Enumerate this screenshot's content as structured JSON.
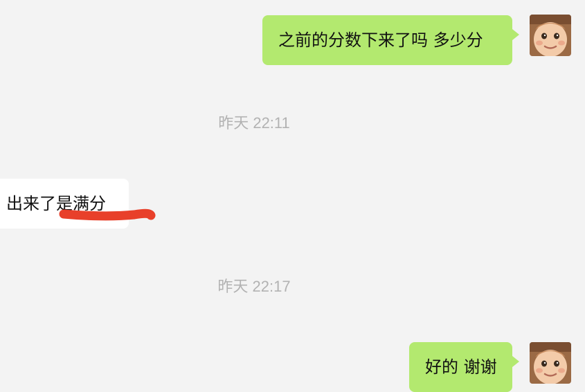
{
  "messages": [
    {
      "id": "m1",
      "direction": "sent",
      "text": "之前的分数下来了吗 多少分"
    },
    {
      "id": "t1",
      "type": "timestamp",
      "text": "昨天 22:11"
    },
    {
      "id": "m2",
      "direction": "received",
      "text": "出来了是满分"
    },
    {
      "id": "t2",
      "type": "timestamp",
      "text": "昨天 22:17"
    },
    {
      "id": "m3",
      "direction": "sent",
      "text": "好的 谢谢"
    }
  ],
  "avatar_icon": "baby-face-avatar",
  "colors": {
    "background": "#f3f3f3",
    "sent_bubble": "#b3e96f",
    "received_bubble": "#ffffff",
    "timestamp": "#b2b2b2",
    "annotation": "#e8402a"
  }
}
